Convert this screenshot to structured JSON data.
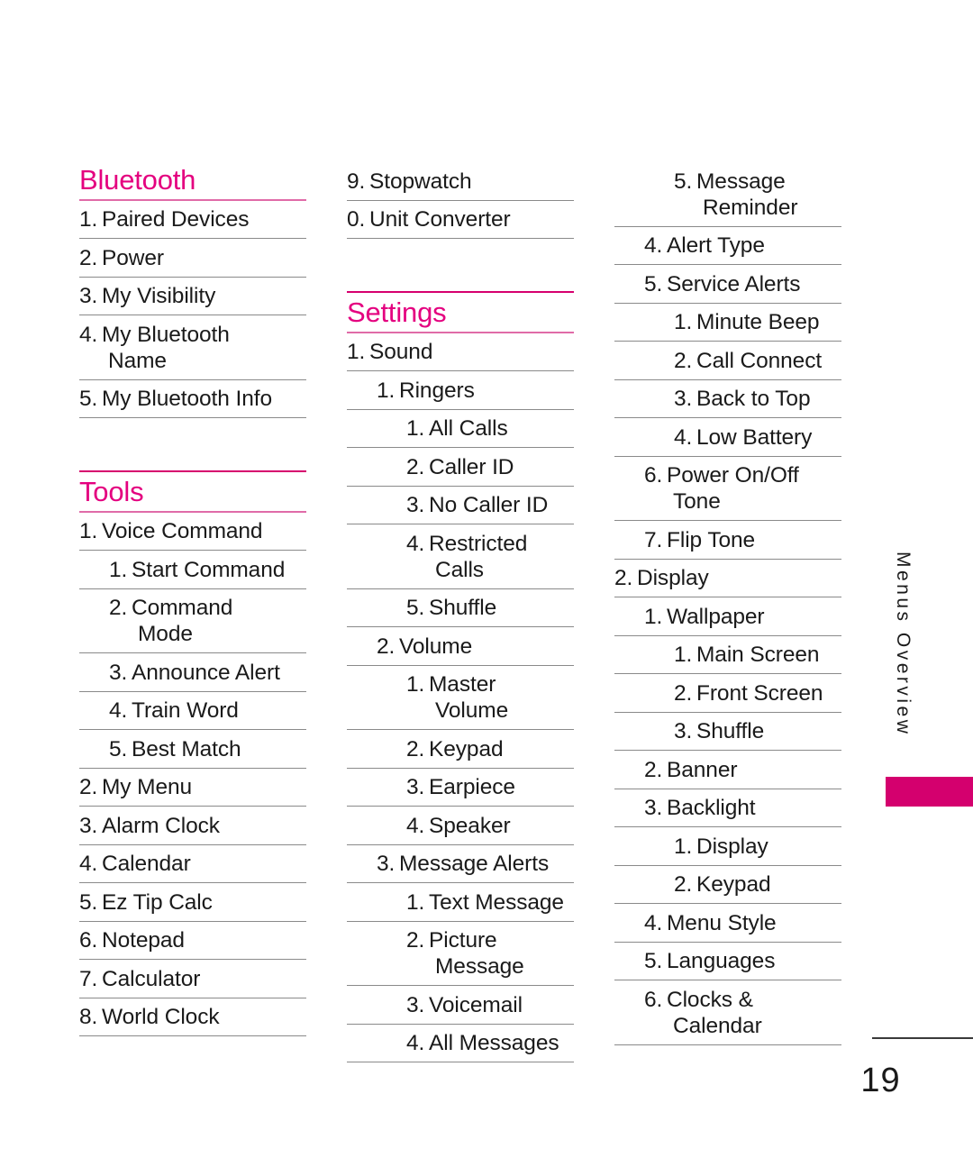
{
  "document": {
    "page_number": "19",
    "side_tab_label": "Menus Overview",
    "accent_color": "#E4007F",
    "tab_block_color": "#D4006E",
    "rule_color": "#8a8a8a"
  },
  "columns": [
    {
      "id": "col-1",
      "sections": [
        {
          "title": "Bluetooth",
          "rule_above": false,
          "items": [
            {
              "num": "1.",
              "label": "Paired Devices",
              "level": 0,
              "lines": 1
            },
            {
              "num": "2.",
              "label": "Power",
              "level": 0,
              "lines": 1
            },
            {
              "num": "3.",
              "label": "My Visibility",
              "level": 0,
              "lines": 1
            },
            {
              "num": "4.",
              "label": "My Bluetooth",
              "label2": "Name",
              "level": 0,
              "lines": 2
            },
            {
              "num": "5.",
              "label": "My Bluetooth Info",
              "level": 0,
              "lines": 1
            }
          ]
        },
        {
          "title": "Tools",
          "rule_above": true,
          "items": [
            {
              "num": "1.",
              "label": "Voice Command",
              "level": 0,
              "lines": 1
            },
            {
              "num": "1.",
              "label": "Start Command",
              "level": 1,
              "lines": 1
            },
            {
              "num": "2.",
              "label": "Command",
              "label2": "Mode",
              "level": 1,
              "lines": 2
            },
            {
              "num": "3.",
              "label": "Announce Alert",
              "level": 1,
              "lines": 1
            },
            {
              "num": "4.",
              "label": "Train Word",
              "level": 1,
              "lines": 1
            },
            {
              "num": "5.",
              "label": "Best Match",
              "level": 1,
              "lines": 1
            },
            {
              "num": "2.",
              "label": "My Menu",
              "level": 0,
              "lines": 1
            },
            {
              "num": "3.",
              "label": "Alarm Clock",
              "level": 0,
              "lines": 1
            },
            {
              "num": "4.",
              "label": "Calendar",
              "level": 0,
              "lines": 1
            },
            {
              "num": "5.",
              "label": "Ez Tip Calc",
              "level": 0,
              "lines": 1
            },
            {
              "num": "6.",
              "label": "Notepad",
              "level": 0,
              "lines": 1
            },
            {
              "num": "7.",
              "label": "Calculator",
              "level": 0,
              "lines": 1
            },
            {
              "num": "8.",
              "label": "World Clock",
              "level": 0,
              "lines": 1
            }
          ]
        }
      ]
    },
    {
      "id": "col-2",
      "sections": [
        {
          "title": null,
          "rule_above": false,
          "items": [
            {
              "num": "9.",
              "label": "Stopwatch",
              "level": 0,
              "lines": 1
            },
            {
              "num": "0.",
              "label": "Unit Converter",
              "level": 0,
              "lines": 1
            }
          ]
        },
        {
          "title": "Settings",
          "rule_above": true,
          "items": [
            {
              "num": "1.",
              "label": "Sound",
              "level": 0,
              "lines": 1
            },
            {
              "num": "1.",
              "label": "Ringers",
              "level": 1,
              "lines": 1
            },
            {
              "num": "1.",
              "label": "All Calls",
              "level": 2,
              "lines": 1
            },
            {
              "num": "2.",
              "label": "Caller ID",
              "level": 2,
              "lines": 1
            },
            {
              "num": "3.",
              "label": "No Caller ID",
              "level": 2,
              "lines": 1
            },
            {
              "num": "4.",
              "label": "Restricted",
              "label2": "Calls",
              "level": 2,
              "lines": 2
            },
            {
              "num": "5.",
              "label": "Shuffle",
              "level": 2,
              "lines": 1
            },
            {
              "num": "2.",
              "label": "Volume",
              "level": 1,
              "lines": 1
            },
            {
              "num": "1.",
              "label": "Master",
              "label2": "Volume",
              "level": 2,
              "lines": 2
            },
            {
              "num": "2.",
              "label": "Keypad",
              "level": 2,
              "lines": 1
            },
            {
              "num": "3.",
              "label": "Earpiece",
              "level": 2,
              "lines": 1
            },
            {
              "num": "4.",
              "label": "Speaker",
              "level": 2,
              "lines": 1
            },
            {
              "num": "3.",
              "label": "Message Alerts",
              "level": 1,
              "lines": 1
            },
            {
              "num": "1.",
              "label": "Text Message",
              "level": 2,
              "lines": 1
            },
            {
              "num": "2.",
              "label": "Picture",
              "label2": "Message",
              "level": 2,
              "lines": 2
            },
            {
              "num": "3.",
              "label": "Voicemail",
              "level": 2,
              "lines": 1
            },
            {
              "num": "4.",
              "label": "All Messages",
              "level": 2,
              "lines": 1
            }
          ]
        }
      ]
    },
    {
      "id": "col-3",
      "sections": [
        {
          "title": null,
          "rule_above": false,
          "items": [
            {
              "num": "5.",
              "label": "Message",
              "label2": "Reminder",
              "level": 2,
              "lines": 2
            },
            {
              "num": "4.",
              "label": "Alert Type",
              "level": 1,
              "lines": 1
            },
            {
              "num": "5.",
              "label": "Service Alerts",
              "level": 1,
              "lines": 1
            },
            {
              "num": "1.",
              "label": "Minute Beep",
              "level": 2,
              "lines": 1
            },
            {
              "num": "2.",
              "label": "Call Connect",
              "level": 2,
              "lines": 1
            },
            {
              "num": "3.",
              "label": "Back to Top",
              "level": 2,
              "lines": 1
            },
            {
              "num": "4.",
              "label": "Low Battery",
              "level": 2,
              "lines": 1
            },
            {
              "num": "6.",
              "label": "Power On/Off",
              "label2": "Tone",
              "level": 1,
              "lines": 2
            },
            {
              "num": "7.",
              "label": "Flip Tone",
              "level": 1,
              "lines": 1
            },
            {
              "num": "2.",
              "label": "Display",
              "level": 0,
              "lines": 1
            },
            {
              "num": "1.",
              "label": "Wallpaper",
              "level": 1,
              "lines": 1
            },
            {
              "num": "1.",
              "label": "Main Screen",
              "level": 2,
              "lines": 1
            },
            {
              "num": "2.",
              "label": "Front Screen",
              "level": 2,
              "lines": 1
            },
            {
              "num": "3.",
              "label": "Shuffle",
              "level": 2,
              "lines": 1
            },
            {
              "num": "2.",
              "label": "Banner",
              "level": 1,
              "lines": 1
            },
            {
              "num": "3.",
              "label": "Backlight",
              "level": 1,
              "lines": 1
            },
            {
              "num": "1.",
              "label": "Display",
              "level": 2,
              "lines": 1
            },
            {
              "num": "2.",
              "label": "Keypad",
              "level": 2,
              "lines": 1
            },
            {
              "num": "4.",
              "label": "Menu Style",
              "level": 1,
              "lines": 1
            },
            {
              "num": "5.",
              "label": "Languages",
              "level": 1,
              "lines": 1
            },
            {
              "num": "6.",
              "label": "Clocks &",
              "label2": "Calendar",
              "level": 1,
              "lines": 2
            }
          ]
        }
      ]
    }
  ]
}
